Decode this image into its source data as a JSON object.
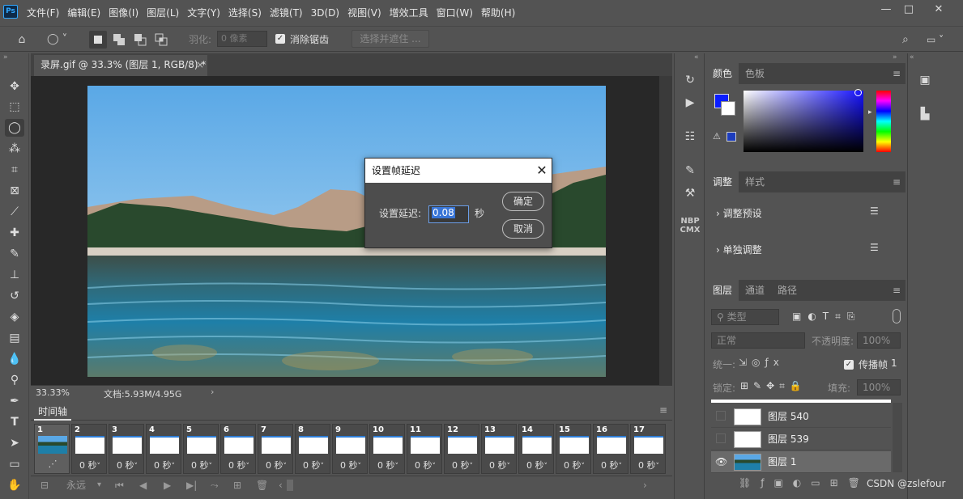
{
  "menubar": {
    "logo": "Ps",
    "items": [
      "文件(F)",
      "编辑(E)",
      "图像(I)",
      "图层(L)",
      "文字(Y)",
      "选择(S)",
      "滤镜(T)",
      "3D(D)",
      "视图(V)",
      "增效工具",
      "窗口(W)",
      "帮助(H)"
    ],
    "win_min": "—",
    "win_max": "□",
    "win_close": "✕"
  },
  "options": {
    "feather_label": "羽化:",
    "feather_value": "0 像素",
    "antialias_label": "消除锯齿",
    "antialias_checked": true,
    "select_mask_label": "选择并遮住 ..."
  },
  "document": {
    "tab_title": "录屏.gif @ 33.3% (图层 1, RGB/8) *",
    "close": "×",
    "zoom": "33.33%",
    "doc_info": "文档:5.93M/4.95G"
  },
  "timeline": {
    "tab_label": "时间轴",
    "frames": [
      {
        "num": "1",
        "delay": "",
        "selected": true
      },
      {
        "num": "2",
        "delay": "0 秒"
      },
      {
        "num": "3",
        "delay": "0 秒"
      },
      {
        "num": "4",
        "delay": "0 秒"
      },
      {
        "num": "5",
        "delay": "0 秒"
      },
      {
        "num": "6",
        "delay": "0 秒"
      },
      {
        "num": "7",
        "delay": "0 秒"
      },
      {
        "num": "8",
        "delay": "0 秒"
      },
      {
        "num": "9",
        "delay": "0 秒"
      },
      {
        "num": "10",
        "delay": "0 秒"
      },
      {
        "num": "11",
        "delay": "0 秒"
      },
      {
        "num": "12",
        "delay": "0 秒"
      },
      {
        "num": "13",
        "delay": "0 秒"
      },
      {
        "num": "14",
        "delay": "0 秒"
      },
      {
        "num": "15",
        "delay": "0 秒"
      },
      {
        "num": "16",
        "delay": "0 秒"
      },
      {
        "num": "17",
        "delay": "0 秒"
      }
    ],
    "loop_label": "永远"
  },
  "dialog": {
    "title": "设置帧延迟",
    "close": "✕",
    "label": "设置延迟:",
    "value": "0.08",
    "unit": "秒",
    "ok": "确定",
    "cancel": "取消"
  },
  "color_panel": {
    "tabs": [
      "颜色",
      "色板"
    ],
    "foreground": "#0a1dff",
    "background": "#ffffff"
  },
  "adjust_panel": {
    "tabs": [
      "调整",
      "样式"
    ],
    "rows": [
      "调整预设",
      "单独调整"
    ]
  },
  "layers_panel": {
    "tabs": [
      "图层",
      "通道",
      "路径"
    ],
    "filter_placeholder": "类型",
    "blend_mode": "正常",
    "opacity_label": "不透明度:",
    "opacity_value": "100%",
    "unify_label": "统一:",
    "propagate_label": "传播帧",
    "propagate_value": "1",
    "lock_label": "锁定:",
    "fill_label": "填充:",
    "fill_value": "100%",
    "layers": [
      {
        "name": "图层 540",
        "visible": false,
        "selected": false
      },
      {
        "name": "图层 539",
        "visible": false,
        "selected": false
      },
      {
        "name": "图层 1",
        "visible": true,
        "selected": true
      }
    ]
  },
  "watermark": "CSDN @zslefour",
  "midstrip": {
    "nbp_line1": "NBP",
    "nbp_line2": "CMX"
  },
  "accent": "#31a8ff"
}
